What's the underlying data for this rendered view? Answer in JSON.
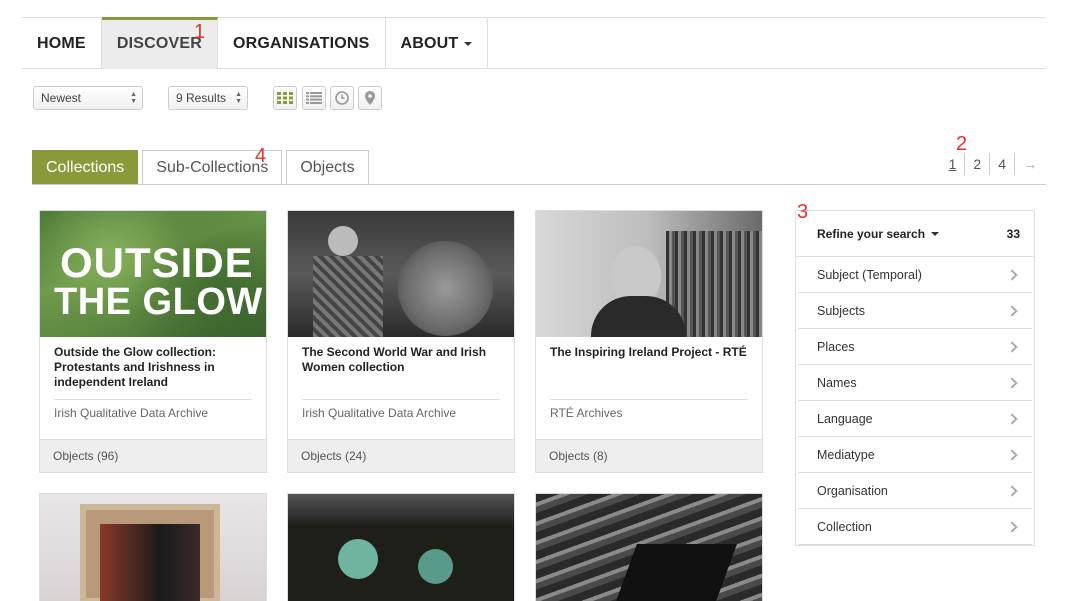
{
  "nav": {
    "items": [
      {
        "label": "HOME"
      },
      {
        "label": "DISCOVER"
      },
      {
        "label": "ORGANISATIONS"
      },
      {
        "label": "ABOUT"
      }
    ]
  },
  "annotations": {
    "a1": "1",
    "a2": "2",
    "a3": "3",
    "a4": "4"
  },
  "toolbar": {
    "sort_value": "Newest",
    "results_value": "9 Results",
    "view_icons": [
      "grid-view-icon",
      "list-view-icon",
      "timeline-icon",
      "map-pin-icon"
    ],
    "accent_color": "#8a9a3a"
  },
  "tabs": [
    {
      "label": "Collections"
    },
    {
      "label": "Sub-Collections"
    },
    {
      "label": "Objects"
    }
  ],
  "pagination": {
    "pages": [
      "1",
      "2",
      "4"
    ],
    "next": "→"
  },
  "cards": [
    {
      "image_text_1": "OUTSIDE",
      "image_text_2": "THE GLOW",
      "title": "Outside the Glow collection: Protestants and Irishness in independent Ireland",
      "org": "Irish Qualitative Data Archive",
      "objects": "Objects (96)"
    },
    {
      "title": "The Second World War and Irish Women collection",
      "org": "Irish Qualitative Data Archive",
      "objects": "Objects (24)"
    },
    {
      "title": "The Inspiring Ireland Project - RTÉ",
      "org": "RTÉ Archives",
      "objects": "Objects (8)"
    }
  ],
  "refine": {
    "title": "Refine your search",
    "count": "33",
    "items": [
      {
        "label": "Subject (Temporal)"
      },
      {
        "label": "Subjects"
      },
      {
        "label": "Places"
      },
      {
        "label": "Names"
      },
      {
        "label": "Language"
      },
      {
        "label": "Mediatype"
      },
      {
        "label": "Organisation"
      },
      {
        "label": "Collection"
      }
    ]
  }
}
